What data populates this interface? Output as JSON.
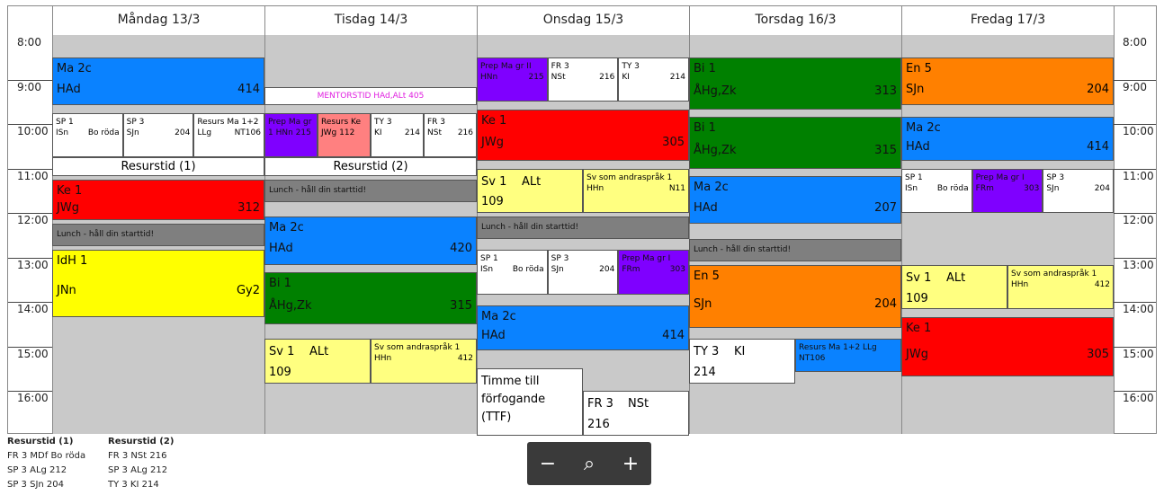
{
  "days": [
    {
      "label": "Måndag 13/3"
    },
    {
      "label": "Tisdag 14/3"
    },
    {
      "label": "Onsdag 15/3"
    },
    {
      "label": "Torsdag 16/3"
    },
    {
      "label": "Fredag 17/3"
    }
  ],
  "hours": [
    "8:00",
    "9:00",
    "10:00",
    "11:00",
    "12:00",
    "13:00",
    "14:00",
    "15:00",
    "16:00"
  ],
  "lessons": [
    {
      "day": 0,
      "start": "8:30",
      "end": "9:35",
      "color": "#0a82ff",
      "lines": [
        {
          "text": "Ma 2c"
        },
        {
          "text": "HAd"
        },
        {
          "text": "414"
        }
      ]
    },
    {
      "day": 0,
      "start": "9:45",
      "end": "10:45",
      "color": "#ffffff",
      "lines": [
        {
          "text": "SP 1"
        },
        {
          "text": "ISn"
        },
        {
          "text": "Bo röda"
        }
      ]
    },
    {
      "day": 0,
      "start": "9:45",
      "end": "10:45",
      "color": "#ffffff",
      "lines": [
        {
          "text": "SP 3"
        },
        {
          "text": "SJn"
        },
        {
          "text": "204"
        }
      ]
    },
    {
      "day": 0,
      "start": "9:45",
      "end": "10:45",
      "color": "#ffffff",
      "lines": [
        {
          "text": "Resurs Ma 1+2"
        },
        {
          "text": "LLg"
        },
        {
          "text": "NT106"
        }
      ]
    },
    {
      "day": 0,
      "start": "10:45",
      "end": "11:10",
      "color": "#ffffff",
      "lines": [
        {
          "text": "Resurstid (1)"
        }
      ]
    },
    {
      "day": 0,
      "start": "11:15",
      "end": "12:10",
      "color": "#ff0000",
      "lines": [
        {
          "text": "Ke 1"
        },
        {
          "text": "JWg"
        },
        {
          "text": "312"
        }
      ]
    },
    {
      "day": 0,
      "start": "12:15",
      "end": "12:45",
      "color": "#7f7f7f",
      "lines": [
        {
          "text": "Lunch - håll din starttid!"
        }
      ]
    },
    {
      "day": 0,
      "start": "12:50",
      "end": "14:20",
      "color": "#ffff00",
      "lines": [
        {
          "text": "IdH 1"
        },
        {
          "text": "JNn"
        },
        {
          "text": "Gy2"
        }
      ]
    },
    {
      "day": 1,
      "start": "9:10",
      "end": "9:35",
      "color": "#ffffff",
      "lines": [
        {
          "text": "MENTORSTID HAd,ALt 405"
        }
      ]
    },
    {
      "day": 1,
      "start": "9:45",
      "end": "10:45",
      "color": "#7f00ff",
      "lines": [
        {
          "text": "Prep Ma gr"
        },
        {
          "text": "1 HNn 215"
        }
      ]
    },
    {
      "day": 1,
      "start": "9:45",
      "end": "10:45",
      "color": "#ff8080",
      "lines": [
        {
          "text": "Resurs Ke"
        },
        {
          "text": "JWg 112"
        }
      ]
    },
    {
      "day": 1,
      "start": "9:45",
      "end": "10:45",
      "color": "#ffffff",
      "lines": [
        {
          "text": "TY 3"
        },
        {
          "text": "KI"
        },
        {
          "text": "214"
        }
      ]
    },
    {
      "day": 1,
      "start": "9:45",
      "end": "10:45",
      "color": "#ffffff",
      "lines": [
        {
          "text": "FR 3"
        },
        {
          "text": "NSt"
        },
        {
          "text": "216"
        }
      ]
    },
    {
      "day": 1,
      "start": "10:45",
      "end": "11:10",
      "color": "#ffffff",
      "lines": [
        {
          "text": "Resurstid (2)"
        }
      ]
    },
    {
      "day": 1,
      "start": "11:15",
      "end": "11:45",
      "color": "#7f7f7f",
      "lines": [
        {
          "text": "Lunch - håll din starttid!"
        }
      ]
    },
    {
      "day": 1,
      "start": "12:05",
      "end": "13:10",
      "color": "#0a82ff",
      "lines": [
        {
          "text": "Ma 2c"
        },
        {
          "text": "HAd"
        },
        {
          "text": "420"
        }
      ]
    },
    {
      "day": 1,
      "start": "13:20",
      "end": "14:30",
      "color": "#008000",
      "lines": [
        {
          "text": "Bi 1"
        },
        {
          "text": "ÅHg,Zk"
        },
        {
          "text": "315"
        }
      ]
    },
    {
      "day": 1,
      "start": "14:50",
      "end": "15:50",
      "color": "#ffff80",
      "lines": [
        {
          "text": "Sv 1"
        },
        {
          "text": "ALt"
        },
        {
          "text": "109"
        }
      ]
    },
    {
      "day": 1,
      "start": "14:50",
      "end": "15:50",
      "color": "#ffff80",
      "lines": [
        {
          "text": "Sv som andraspråk 1"
        },
        {
          "text": "HHn"
        },
        {
          "text": "412"
        }
      ]
    },
    {
      "day": 2,
      "start": "8:30",
      "end": "9:30",
      "color": "#7f00ff",
      "lines": [
        {
          "text": "Prep Ma gr II"
        },
        {
          "text": "HNn"
        },
        {
          "text": "215"
        }
      ]
    },
    {
      "day": 2,
      "start": "8:30",
      "end": "9:30",
      "color": "#ffffff",
      "lines": [
        {
          "text": "FR 3"
        },
        {
          "text": "NSt"
        },
        {
          "text": "216"
        }
      ]
    },
    {
      "day": 2,
      "start": "8:30",
      "end": "9:30",
      "color": "#ffffff",
      "lines": [
        {
          "text": "TY 3"
        },
        {
          "text": "KI"
        },
        {
          "text": "214"
        }
      ]
    },
    {
      "day": 2,
      "start": "9:40",
      "end": "10:50",
      "color": "#ff0000",
      "lines": [
        {
          "text": "Ke 1"
        },
        {
          "text": "JWg"
        },
        {
          "text": "305"
        }
      ]
    },
    {
      "day": 2,
      "start": "11:00",
      "end": "12:00",
      "color": "#ffff80",
      "lines": [
        {
          "text": "Sv 1"
        },
        {
          "text": "ALt"
        },
        {
          "text": "109"
        }
      ]
    },
    {
      "day": 2,
      "start": "11:00",
      "end": "12:00",
      "color": "#ffff80",
      "lines": [
        {
          "text": "Sv som andraspråk 1"
        },
        {
          "text": "HHn"
        },
        {
          "text": "N11"
        }
      ]
    },
    {
      "day": 2,
      "start": "12:05",
      "end": "12:35",
      "color": "#7f7f7f",
      "lines": [
        {
          "text": "Lunch - håll din starttid!"
        }
      ]
    },
    {
      "day": 2,
      "start": "12:50",
      "end": "13:50",
      "color": "#ffffff",
      "lines": [
        {
          "text": "SP 1"
        },
        {
          "text": "ISn"
        },
        {
          "text": "Bo röda"
        }
      ]
    },
    {
      "day": 2,
      "start": "12:50",
      "end": "13:50",
      "color": "#ffffff",
      "lines": [
        {
          "text": "SP 3"
        },
        {
          "text": "SJn"
        },
        {
          "text": "204"
        }
      ]
    },
    {
      "day": 2,
      "start": "12:50",
      "end": "13:50",
      "color": "#7f00ff",
      "lines": [
        {
          "text": "Prep Ma gr I"
        },
        {
          "text": "FRm"
        },
        {
          "text": "303"
        }
      ]
    },
    {
      "day": 2,
      "start": "14:05",
      "end": "15:05",
      "color": "#0a82ff",
      "lines": [
        {
          "text": "Ma 2c"
        },
        {
          "text": "HAd"
        },
        {
          "text": "414"
        }
      ]
    },
    {
      "day": 2,
      "start": "15:30",
      "end": "17:00",
      "color": "#ffffff",
      "lines": [
        {
          "text": "Timme till"
        },
        {
          "text": "förfogande"
        },
        {
          "text": "(TTF)"
        }
      ]
    },
    {
      "day": 2,
      "start": "16:00",
      "end": "17:00",
      "color": "#ffffff",
      "lines": [
        {
          "text": "FR 3"
        },
        {
          "text": "NSt"
        },
        {
          "text": "216"
        }
      ]
    },
    {
      "day": 3,
      "start": "8:30",
      "end": "9:40",
      "color": "#008000",
      "lines": [
        {
          "text": "Bi 1"
        },
        {
          "text": "ÅHg,Zk"
        },
        {
          "text": "313"
        }
      ]
    },
    {
      "day": 3,
      "start": "9:50",
      "end": "11:00",
      "color": "#008000",
      "lines": [
        {
          "text": "Bi 1"
        },
        {
          "text": "ÅHg,Zk"
        },
        {
          "text": "315"
        }
      ]
    },
    {
      "day": 3,
      "start": "11:10",
      "end": "12:15",
      "color": "#0a82ff",
      "lines": [
        {
          "text": "Ma 2c"
        },
        {
          "text": "HAd"
        },
        {
          "text": "207"
        }
      ]
    },
    {
      "day": 3,
      "start": "12:35",
      "end": "13:05",
      "color": "#7f7f7f",
      "lines": [
        {
          "text": "Lunch - håll din starttid!"
        }
      ]
    },
    {
      "day": 3,
      "start": "13:10",
      "end": "14:35",
      "color": "#ff8000",
      "lines": [
        {
          "text": "En 5"
        },
        {
          "text": "SJn"
        },
        {
          "text": "204"
        }
      ]
    },
    {
      "day": 3,
      "start": "14:50",
      "end": "15:50",
      "color": "#ffffff",
      "lines": [
        {
          "text": "TY 3"
        },
        {
          "text": "KI"
        },
        {
          "text": "214"
        }
      ]
    },
    {
      "day": 3,
      "start": "14:50",
      "end": "15:35",
      "color": "#0a82ff",
      "lines": [
        {
          "text": "Resurs Ma 1+2 LLg"
        },
        {
          "text": "NT106"
        }
      ]
    },
    {
      "day": 4,
      "start": "8:30",
      "end": "9:35",
      "color": "#ff8000",
      "lines": [
        {
          "text": "En 5"
        },
        {
          "text": "SJn"
        },
        {
          "text": "204"
        }
      ]
    },
    {
      "day": 4,
      "start": "9:50",
      "end": "10:50",
      "color": "#0a82ff",
      "lines": [
        {
          "text": "Ma 2c"
        },
        {
          "text": "HAd"
        },
        {
          "text": "414"
        }
      ]
    },
    {
      "day": 4,
      "start": "11:00",
      "end": "12:00",
      "color": "#ffffff",
      "lines": [
        {
          "text": "SP 1"
        },
        {
          "text": "ISn"
        },
        {
          "text": "Bo röda"
        }
      ]
    },
    {
      "day": 4,
      "start": "11:00",
      "end": "12:00",
      "color": "#7f00ff",
      "lines": [
        {
          "text": "Prep Ma gr I"
        },
        {
          "text": "FRm"
        },
        {
          "text": "303"
        }
      ]
    },
    {
      "day": 4,
      "start": "11:00",
      "end": "12:00",
      "color": "#ffffff",
      "lines": [
        {
          "text": "SP 3"
        },
        {
          "text": "SJn"
        },
        {
          "text": "204"
        }
      ]
    },
    {
      "day": 4,
      "start": "13:10",
      "end": "14:10",
      "color": "#ffff80",
      "lines": [
        {
          "text": "Sv 1"
        },
        {
          "text": "ALt"
        },
        {
          "text": "109"
        }
      ]
    },
    {
      "day": 4,
      "start": "13:10",
      "end": "14:10",
      "color": "#ffff80",
      "lines": [
        {
          "text": "Sv som andraspråk 1"
        },
        {
          "text": "HHn"
        },
        {
          "text": "412"
        }
      ]
    },
    {
      "day": 4,
      "start": "14:20",
      "end": "15:40",
      "color": "#ff0000",
      "lines": [
        {
          "text": "Ke 1"
        },
        {
          "text": "JWg"
        },
        {
          "text": "305"
        }
      ]
    }
  ],
  "legend": {
    "col1_title": "Resurstid (1)",
    "col1_rows": [
      "FR 3  MDf  Bo röda",
      "SP 3  ALg  212",
      "SP 3  SJn   204"
    ],
    "col2_title": "Resurstid (2)",
    "col2_rows": [
      "FR 3  NSt  216",
      "SP 3  ALg  212",
      "TY 3  KI    214"
    ]
  },
  "zoom": {
    "out": "−",
    "reset": "⌕",
    "in": "+"
  }
}
